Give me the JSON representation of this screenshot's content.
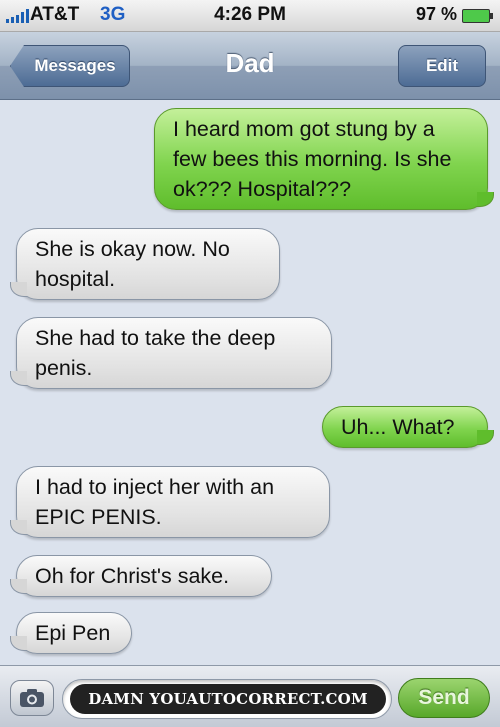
{
  "status_bar": {
    "carrier": "AT&T",
    "network": "3G",
    "time": "4:26 PM",
    "battery": "97 %"
  },
  "nav": {
    "back_label": "Messages",
    "title": "Dad",
    "edit_label": "Edit"
  },
  "messages": [
    {
      "direction": "outgoing",
      "text": "I heard mom got stung by a few bees this morning. Is she ok??? Hospital???"
    },
    {
      "direction": "incoming",
      "text": "She is okay now. No hospital."
    },
    {
      "direction": "incoming",
      "text": "She had to take the deep penis."
    },
    {
      "direction": "outgoing",
      "text": "Uh... What?"
    },
    {
      "direction": "incoming",
      "text": "I had to inject her with an EPIC PENIS."
    },
    {
      "direction": "incoming",
      "text": "Oh for Christ's sake."
    },
    {
      "direction": "incoming",
      "text": "Epi Pen"
    }
  ],
  "input_bar": {
    "camera_icon": "camera-icon",
    "watermark": "DAMN YOUAUTOCORRECT.COM",
    "send_label": "Send"
  },
  "colors": {
    "outgoing_bubble": "#80d44e",
    "incoming_bubble": "#e2e2e2",
    "background": "#dbe2ed",
    "network_text": "#1f5fc4"
  }
}
